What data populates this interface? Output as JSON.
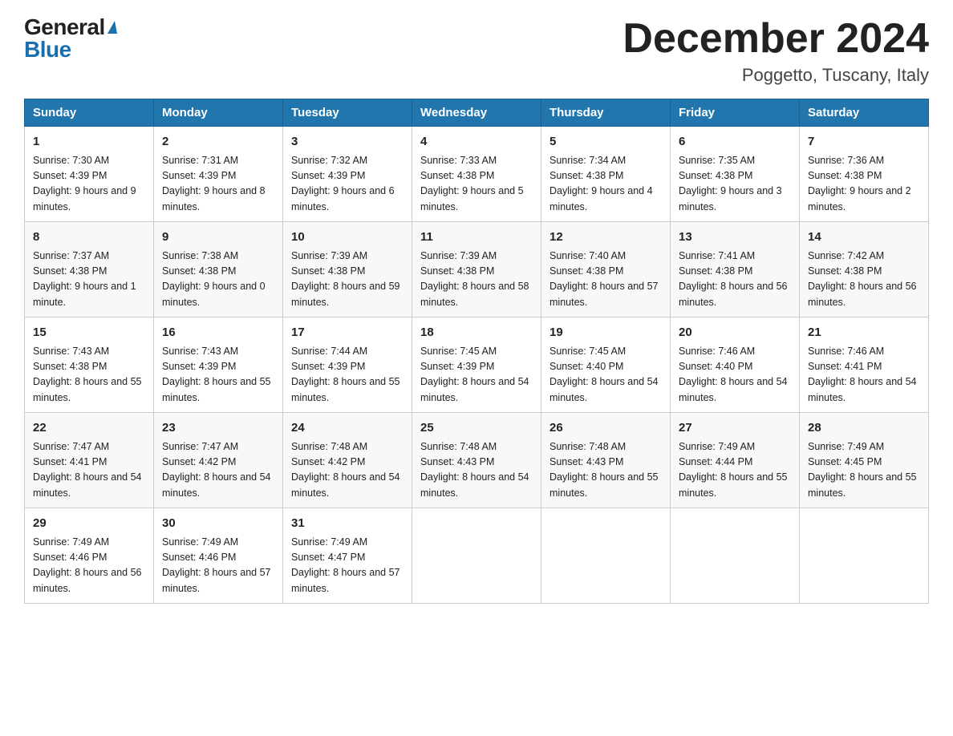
{
  "logo": {
    "general": "General",
    "blue": "Blue"
  },
  "header": {
    "title": "December 2024",
    "subtitle": "Poggetto, Tuscany, Italy"
  },
  "days_of_week": [
    "Sunday",
    "Monday",
    "Tuesday",
    "Wednesday",
    "Thursday",
    "Friday",
    "Saturday"
  ],
  "weeks": [
    [
      {
        "num": "1",
        "sunrise": "7:30 AM",
        "sunset": "4:39 PM",
        "daylight": "9 hours and 9 minutes."
      },
      {
        "num": "2",
        "sunrise": "7:31 AM",
        "sunset": "4:39 PM",
        "daylight": "9 hours and 8 minutes."
      },
      {
        "num": "3",
        "sunrise": "7:32 AM",
        "sunset": "4:39 PM",
        "daylight": "9 hours and 6 minutes."
      },
      {
        "num": "4",
        "sunrise": "7:33 AM",
        "sunset": "4:38 PM",
        "daylight": "9 hours and 5 minutes."
      },
      {
        "num": "5",
        "sunrise": "7:34 AM",
        "sunset": "4:38 PM",
        "daylight": "9 hours and 4 minutes."
      },
      {
        "num": "6",
        "sunrise": "7:35 AM",
        "sunset": "4:38 PM",
        "daylight": "9 hours and 3 minutes."
      },
      {
        "num": "7",
        "sunrise": "7:36 AM",
        "sunset": "4:38 PM",
        "daylight": "9 hours and 2 minutes."
      }
    ],
    [
      {
        "num": "8",
        "sunrise": "7:37 AM",
        "sunset": "4:38 PM",
        "daylight": "9 hours and 1 minute."
      },
      {
        "num": "9",
        "sunrise": "7:38 AM",
        "sunset": "4:38 PM",
        "daylight": "9 hours and 0 minutes."
      },
      {
        "num": "10",
        "sunrise": "7:39 AM",
        "sunset": "4:38 PM",
        "daylight": "8 hours and 59 minutes."
      },
      {
        "num": "11",
        "sunrise": "7:39 AM",
        "sunset": "4:38 PM",
        "daylight": "8 hours and 58 minutes."
      },
      {
        "num": "12",
        "sunrise": "7:40 AM",
        "sunset": "4:38 PM",
        "daylight": "8 hours and 57 minutes."
      },
      {
        "num": "13",
        "sunrise": "7:41 AM",
        "sunset": "4:38 PM",
        "daylight": "8 hours and 56 minutes."
      },
      {
        "num": "14",
        "sunrise": "7:42 AM",
        "sunset": "4:38 PM",
        "daylight": "8 hours and 56 minutes."
      }
    ],
    [
      {
        "num": "15",
        "sunrise": "7:43 AM",
        "sunset": "4:38 PM",
        "daylight": "8 hours and 55 minutes."
      },
      {
        "num": "16",
        "sunrise": "7:43 AM",
        "sunset": "4:39 PM",
        "daylight": "8 hours and 55 minutes."
      },
      {
        "num": "17",
        "sunrise": "7:44 AM",
        "sunset": "4:39 PM",
        "daylight": "8 hours and 55 minutes."
      },
      {
        "num": "18",
        "sunrise": "7:45 AM",
        "sunset": "4:39 PM",
        "daylight": "8 hours and 54 minutes."
      },
      {
        "num": "19",
        "sunrise": "7:45 AM",
        "sunset": "4:40 PM",
        "daylight": "8 hours and 54 minutes."
      },
      {
        "num": "20",
        "sunrise": "7:46 AM",
        "sunset": "4:40 PM",
        "daylight": "8 hours and 54 minutes."
      },
      {
        "num": "21",
        "sunrise": "7:46 AM",
        "sunset": "4:41 PM",
        "daylight": "8 hours and 54 minutes."
      }
    ],
    [
      {
        "num": "22",
        "sunrise": "7:47 AM",
        "sunset": "4:41 PM",
        "daylight": "8 hours and 54 minutes."
      },
      {
        "num": "23",
        "sunrise": "7:47 AM",
        "sunset": "4:42 PM",
        "daylight": "8 hours and 54 minutes."
      },
      {
        "num": "24",
        "sunrise": "7:48 AM",
        "sunset": "4:42 PM",
        "daylight": "8 hours and 54 minutes."
      },
      {
        "num": "25",
        "sunrise": "7:48 AM",
        "sunset": "4:43 PM",
        "daylight": "8 hours and 54 minutes."
      },
      {
        "num": "26",
        "sunrise": "7:48 AM",
        "sunset": "4:43 PM",
        "daylight": "8 hours and 55 minutes."
      },
      {
        "num": "27",
        "sunrise": "7:49 AM",
        "sunset": "4:44 PM",
        "daylight": "8 hours and 55 minutes."
      },
      {
        "num": "28",
        "sunrise": "7:49 AM",
        "sunset": "4:45 PM",
        "daylight": "8 hours and 55 minutes."
      }
    ],
    [
      {
        "num": "29",
        "sunrise": "7:49 AM",
        "sunset": "4:46 PM",
        "daylight": "8 hours and 56 minutes."
      },
      {
        "num": "30",
        "sunrise": "7:49 AM",
        "sunset": "4:46 PM",
        "daylight": "8 hours and 57 minutes."
      },
      {
        "num": "31",
        "sunrise": "7:49 AM",
        "sunset": "4:47 PM",
        "daylight": "8 hours and 57 minutes."
      },
      null,
      null,
      null,
      null
    ]
  ]
}
